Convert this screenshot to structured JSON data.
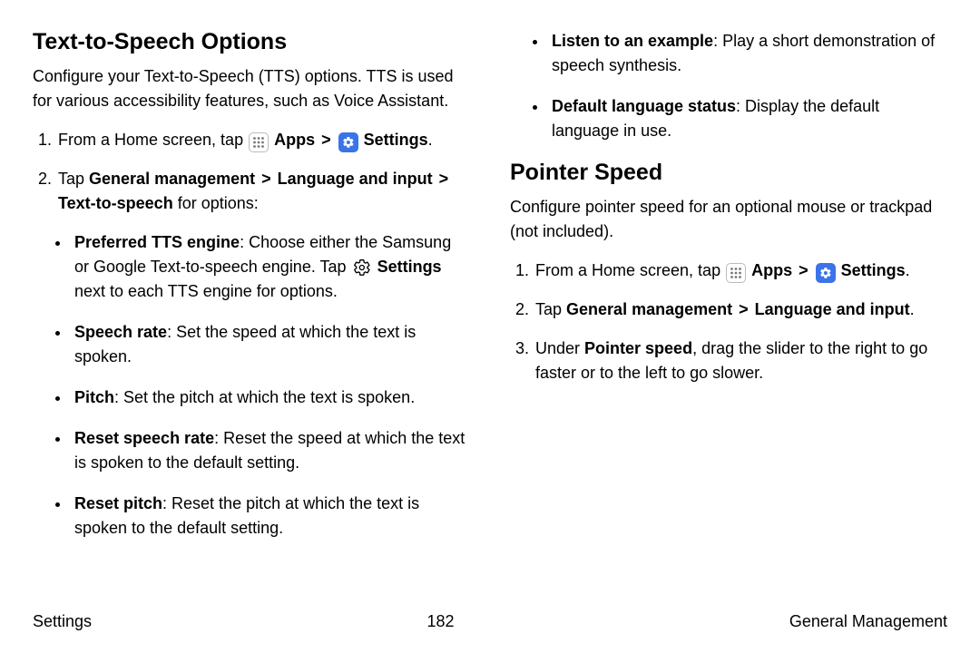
{
  "left": {
    "heading": "Text-to-Speech Options",
    "desc": "Configure your Text-to-Speech (TTS) options. TTS is used for various accessibility features, such as Voice Assistant.",
    "step1_pre": "From a Home screen, tap ",
    "apps": "Apps",
    "settings": "Settings",
    "step2_pre": "Tap ",
    "gm": "General management",
    "li": "Language and input",
    "tts": "Text-to-speech",
    "step2_post": " for options:",
    "bullets": {
      "preferred_t": "Preferred TTS engine",
      "preferred_b": ": Choose either the Samsung or Google Text-to-speech engine. Tap ",
      "preferred_c": "Settings",
      "preferred_d": " next to each TTS engine for options.",
      "speech_t": "Speech rate",
      "speech_b": ": Set the speed at which the text is spoken.",
      "pitch_t": "Pitch",
      "pitch_b": ": Set the pitch at which the text is spoken.",
      "resetsp_t": "Reset speech rate",
      "resetsp_b": ": Reset the speed at which the text is spoken to the default setting.",
      "resetp_t": "Reset pitch",
      "resetp_b": ": Reset the pitch at which the text is spoken to the default setting."
    }
  },
  "right": {
    "cont_bullets": {
      "listen_t": "Listen to an example",
      "listen_b": ": Play a short demonstration of speech synthesis.",
      "default_t": "Default language status",
      "default_b": ": Display the default language in use."
    },
    "heading": "Pointer Speed",
    "desc": "Configure pointer speed for an optional mouse or trackpad (not included).",
    "step1_pre": "From a Home screen, tap ",
    "apps": "Apps",
    "settings": "Settings",
    "step2_pre": "Tap ",
    "gm": "General management",
    "li": "Language and input",
    "step3_a": "Under ",
    "step3_b": "Pointer speed",
    "step3_c": ", drag the slider to the right to go faster or to the left to go slower."
  },
  "footer": {
    "left": "Settings",
    "center": "182",
    "right": "General Management"
  },
  "chev": ">",
  "period": "."
}
